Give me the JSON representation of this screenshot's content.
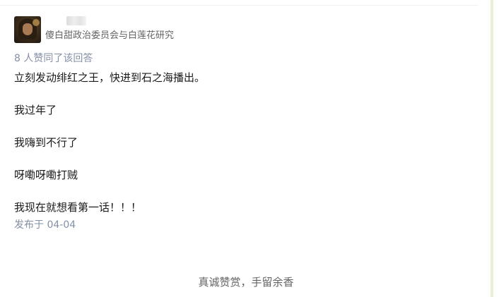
{
  "author": {
    "avatar_icon": "user-avatar-photo",
    "name": "",
    "headline": "傻白甜政治委员会与白莲花研究"
  },
  "voters_text": "8 人赞同了该回答",
  "answer": {
    "paragraphs": [
      "立刻发动绯红之王，快进到石之海播出。",
      "我过年了",
      "我嗨到不行了",
      "呀嘞呀嘞打贼",
      "我现在就想看第一话！！！"
    ]
  },
  "published": "发布于 04-04",
  "reward_text": "真诚赞赏，手留余香",
  "colors": {
    "meta_gray": "#8590a6",
    "body_text": "#1a1a1a",
    "secondary_text": "#646464"
  }
}
